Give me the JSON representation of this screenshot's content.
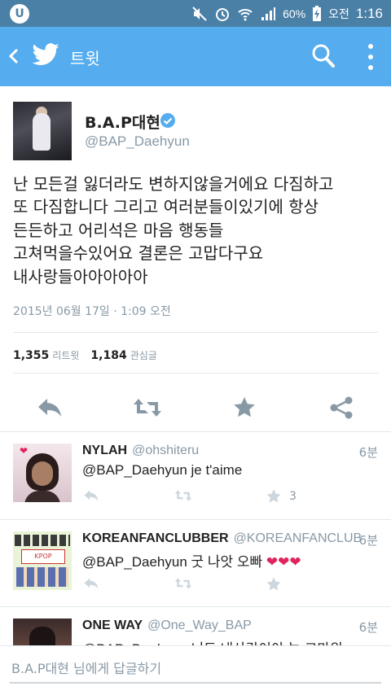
{
  "statusbar": {
    "battery": "60%",
    "ampm": "오전",
    "time": "1:16"
  },
  "appbar": {
    "title": "트윗"
  },
  "tweet": {
    "name": "B.A.P대현",
    "handle": "@BAP_Daehyun",
    "text": "난 모든걸 잃더라도 변하지않을거에요  다짐하고\n또 다짐합니다  그리고 여러분들이있기에 항상\n든든하고 어리석은 마음 행동들\n고쳐먹을수있어요  결론은 고맙다구요\n내사랑들아아아아아",
    "timestamp": "2015년 06월 17일 · 1:09 오전",
    "retweets_count": "1,355",
    "retweets_label": "리트윗",
    "favorites_count": "1,184",
    "favorites_label": "관심글"
  },
  "replies": [
    {
      "name": "NYLAH",
      "handle": "@ohshiteru",
      "time": "6분",
      "text": "@BAP_Daehyun je t'aime",
      "fav_count": "3"
    },
    {
      "name": "KOREANFANCLUBBER",
      "handle": "@KOREANFANCLUB",
      "time": "6분",
      "text": "@BAP_Daehyun 굿 나앗 오빠",
      "fav_count": ""
    },
    {
      "name": "ONE WAY",
      "handle": "@One_Way_BAP",
      "time": "6분",
      "text": "@BAP_Daehyun 너도 내사랑이야 늘 고마워",
      "fav_count": ""
    }
  ],
  "compose": {
    "placeholder": "B.A.P대현 님에게 답글하기"
  },
  "colors": {
    "twitter_blue": "#55acee",
    "statusbar": "#4a7fa6",
    "heart": "#e0245e"
  }
}
